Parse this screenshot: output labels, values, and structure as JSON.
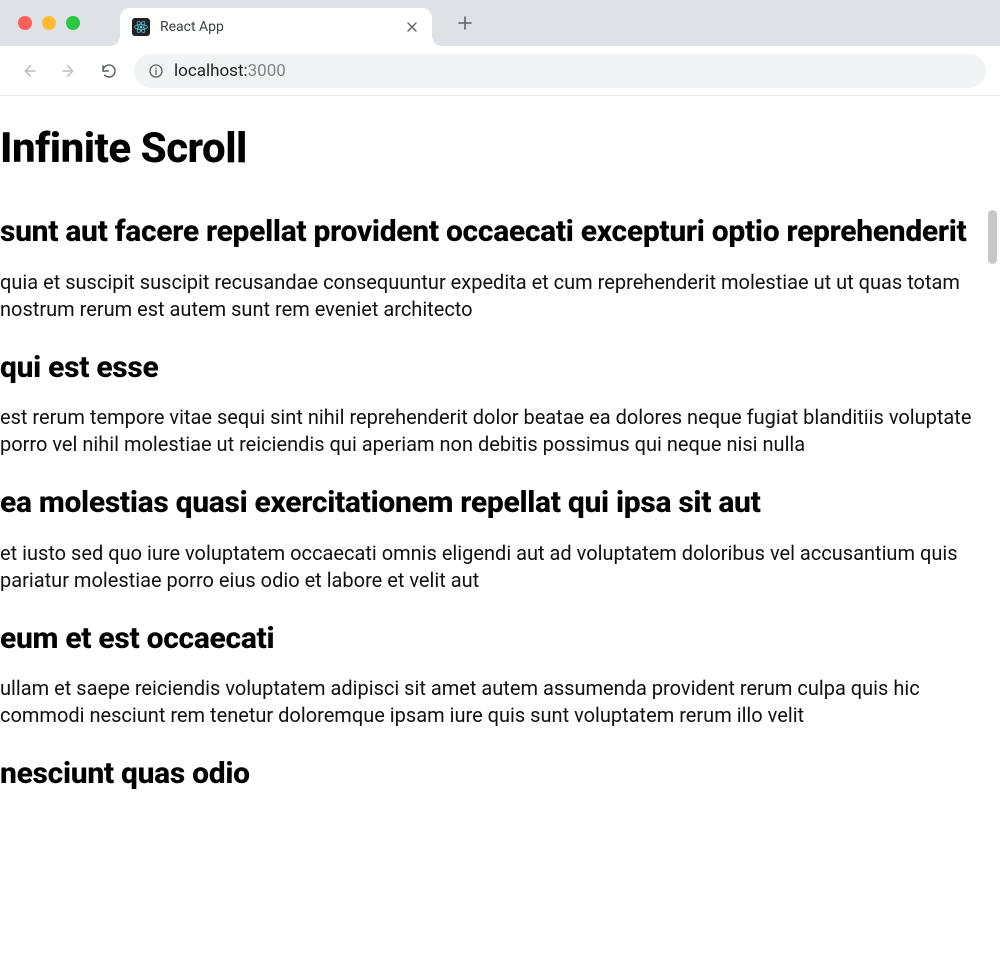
{
  "browser": {
    "tab_title": "React App",
    "url_host": "localhost:",
    "url_port": "3000"
  },
  "page": {
    "title": "Infinite Scroll",
    "posts": [
      {
        "title": "sunt aut facere repellat provident occaecati excepturi optio reprehenderit",
        "body": "quia et suscipit suscipit recusandae consequuntur expedita et cum reprehenderit molestiae ut ut quas totam nostrum rerum est autem sunt rem eveniet architecto"
      },
      {
        "title": "qui est esse",
        "body": "est rerum tempore vitae sequi sint nihil reprehenderit dolor beatae ea dolores neque fugiat blanditiis voluptate porro vel nihil molestiae ut reiciendis qui aperiam non debitis possimus qui neque nisi nulla"
      },
      {
        "title": "ea molestias quasi exercitationem repellat qui ipsa sit aut",
        "body": "et iusto sed quo iure voluptatem occaecati omnis eligendi aut ad voluptatem doloribus vel accusantium quis pariatur molestiae porro eius odio et labore et velit aut"
      },
      {
        "title": "eum et est occaecati",
        "body": "ullam et saepe reiciendis voluptatem adipisci sit amet autem assumenda provident rerum culpa quis hic commodi nesciunt rem tenetur doloremque ipsam iure quis sunt voluptatem rerum illo velit"
      },
      {
        "title": "nesciunt quas odio",
        "body": ""
      }
    ]
  }
}
